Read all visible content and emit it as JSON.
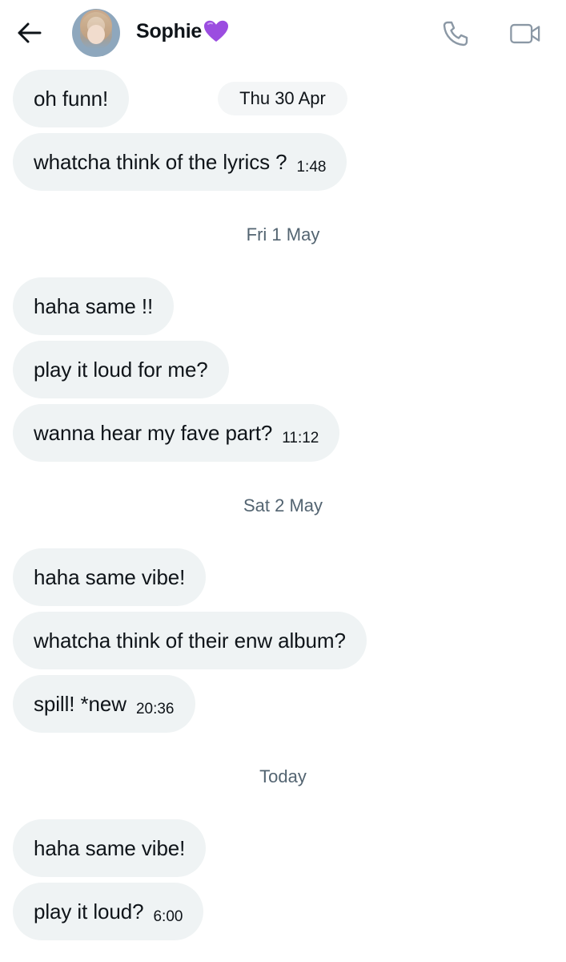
{
  "header": {
    "contact_name": "Sophie",
    "heart_emoji": "💜",
    "back_icon": "arrow-left-icon",
    "call_icon": "phone-icon",
    "video_icon": "video-camera-icon"
  },
  "colors": {
    "bubble_bg": "#eff3f4",
    "date_text": "#536471",
    "text": "#0f1419",
    "icon_gray": "#8b98a5",
    "heart": "#9b4de0"
  },
  "floating_date": "Thu 30 Apr",
  "messages": [
    {
      "text": "oh funn!"
    },
    {
      "text": "whatcha think of the lyrics ?",
      "time": "1:48"
    },
    {
      "date_separator": "Fri 1 May"
    },
    {
      "text": "haha same !!"
    },
    {
      "text": "play it loud for me?"
    },
    {
      "text": "wanna hear my fave part?",
      "time": "11:12"
    },
    {
      "date_separator": "Sat 2 May"
    },
    {
      "text": "haha same vibe!"
    },
    {
      "text": "whatcha think of their enw album?"
    },
    {
      "text": "spill! *new",
      "time": "20:36"
    },
    {
      "date_separator": "Today"
    },
    {
      "text": "haha same vibe!"
    },
    {
      "text": "play it loud?",
      "time": "6:00"
    }
  ]
}
